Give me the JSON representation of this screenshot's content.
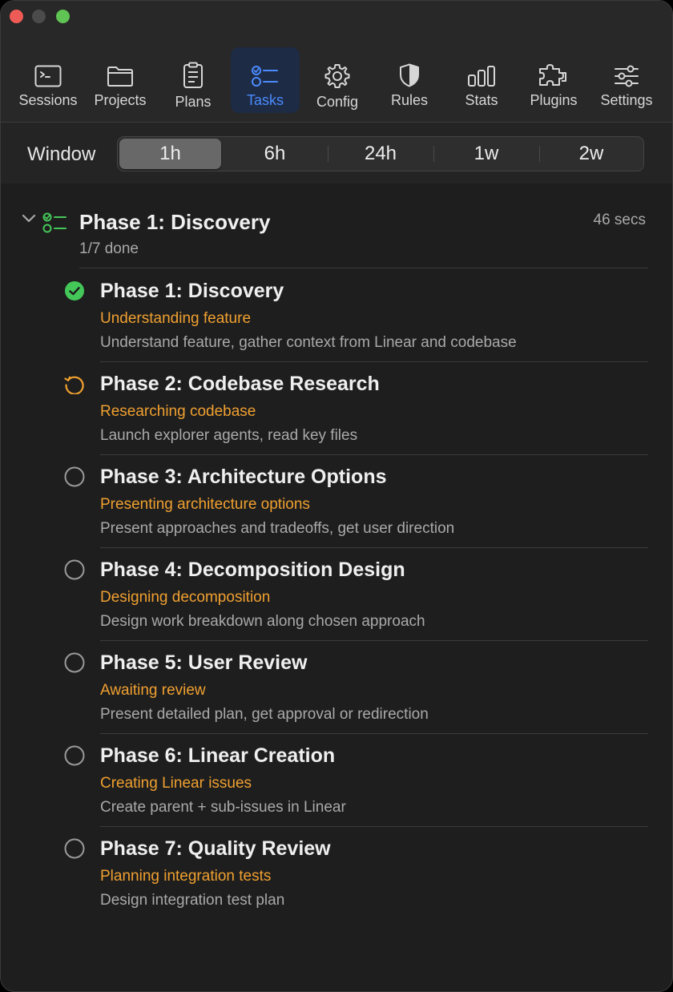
{
  "toolbar": {
    "items": [
      {
        "label": "Sessions",
        "icon": "terminal-icon"
      },
      {
        "label": "Projects",
        "icon": "folder-icon"
      },
      {
        "label": "Plans",
        "icon": "clipboard-icon"
      },
      {
        "label": "Tasks",
        "icon": "checklist-icon",
        "active": true
      },
      {
        "label": "Config",
        "icon": "gear-icon"
      },
      {
        "label": "Rules",
        "icon": "shield-icon"
      },
      {
        "label": "Stats",
        "icon": "bar-chart-icon"
      },
      {
        "label": "Plugins",
        "icon": "puzzle-icon"
      },
      {
        "label": "Settings",
        "icon": "sliders-icon"
      }
    ]
  },
  "window_filter": {
    "label": "Window",
    "options": [
      "1h",
      "6h",
      "24h",
      "1w",
      "2w"
    ],
    "selected": "1h"
  },
  "group": {
    "title": "Phase 1: Discovery",
    "progress": "1/7 done",
    "elapsed": "46 secs"
  },
  "tasks": [
    {
      "title": "Phase 1: Discovery",
      "activity": "Understanding feature",
      "description": "Understand feature, gather context from Linear and codebase",
      "status": "completed"
    },
    {
      "title": "Phase 2: Codebase Research",
      "activity": "Researching codebase",
      "description": "Launch explorer agents, read key files",
      "status": "in-progress"
    },
    {
      "title": "Phase 3: Architecture Options",
      "activity": "Presenting architecture options",
      "description": "Present approaches and tradeoffs, get user direction",
      "status": "pending"
    },
    {
      "title": "Phase 4: Decomposition Design",
      "activity": "Designing decomposition",
      "description": "Design work breakdown along chosen approach",
      "status": "pending"
    },
    {
      "title": "Phase 5: User Review",
      "activity": "Awaiting review",
      "description": "Present detailed plan, get approval or redirection",
      "status": "pending"
    },
    {
      "title": "Phase 6: Linear Creation",
      "activity": "Creating Linear issues",
      "description": "Create parent + sub-issues in Linear",
      "status": "pending"
    },
    {
      "title": "Phase 7: Quality Review",
      "activity": "Planning integration tests",
      "description": "Design integration test plan",
      "status": "pending"
    }
  ],
  "colors": {
    "accent_blue": "#4a8bff",
    "activity_orange": "#f0a030",
    "done_green": "#44c759"
  }
}
